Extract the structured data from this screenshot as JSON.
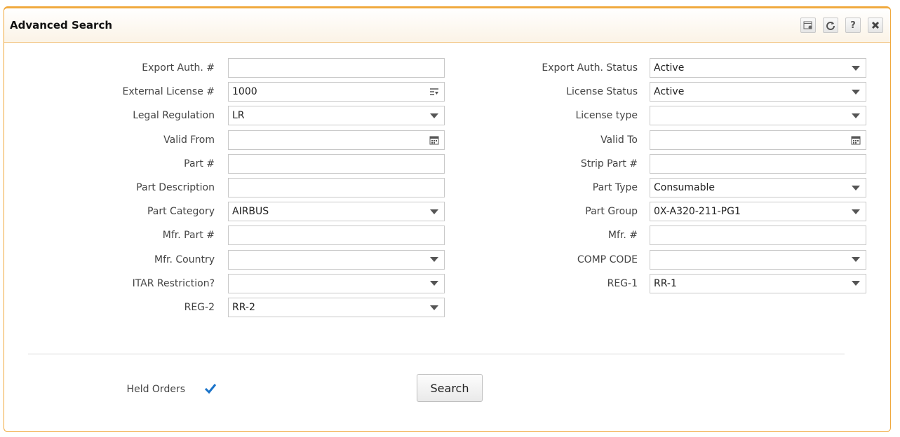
{
  "window": {
    "title": "Advanced Search",
    "tools": [
      "settings-icon",
      "refresh-icon",
      "help-icon",
      "close-icon"
    ],
    "help_glyph": "?"
  },
  "left": [
    {
      "label": "Export Auth. #",
      "value": "",
      "kind": "text"
    },
    {
      "label": "External License #",
      "value": "1000",
      "kind": "list"
    },
    {
      "label": "Legal Regulation",
      "value": "LR",
      "kind": "select"
    },
    {
      "label": "Valid From",
      "value": "",
      "kind": "date"
    },
    {
      "label": "Part #",
      "value": "",
      "kind": "text"
    },
    {
      "label": "Part Description",
      "value": "",
      "kind": "text"
    },
    {
      "label": "Part Category",
      "value": "AIRBUS",
      "kind": "select"
    },
    {
      "label": "Mfr. Part #",
      "value": "",
      "kind": "text"
    },
    {
      "label": "Mfr. Country",
      "value": "",
      "kind": "select"
    },
    {
      "label": "ITAR Restriction?",
      "value": "",
      "kind": "select"
    },
    {
      "label": "REG-2",
      "value": "RR-2",
      "kind": "select"
    }
  ],
  "right": [
    {
      "label": "Export Auth. Status",
      "value": "Active",
      "kind": "select"
    },
    {
      "label": "License Status",
      "value": "Active",
      "kind": "select"
    },
    {
      "label": "License type",
      "value": "",
      "kind": "select"
    },
    {
      "label": "Valid To",
      "value": "",
      "kind": "date"
    },
    {
      "label": "Strip Part #",
      "value": "",
      "kind": "text"
    },
    {
      "label": "Part Type",
      "value": "Consumable",
      "kind": "select"
    },
    {
      "label": "Part Group",
      "value": "0X-A320-211-PG1",
      "kind": "select"
    },
    {
      "label": "Mfr. #",
      "value": "",
      "kind": "text"
    },
    {
      "label": "COMP CODE",
      "value": "",
      "kind": "select"
    },
    {
      "label": "REG-1",
      "value": "RR-1",
      "kind": "select"
    }
  ],
  "held_orders": {
    "label": "Held Orders",
    "checked": true
  },
  "search_button": "Search",
  "colors": {
    "accent": "#f0a93e",
    "check": "#1a73c9"
  }
}
